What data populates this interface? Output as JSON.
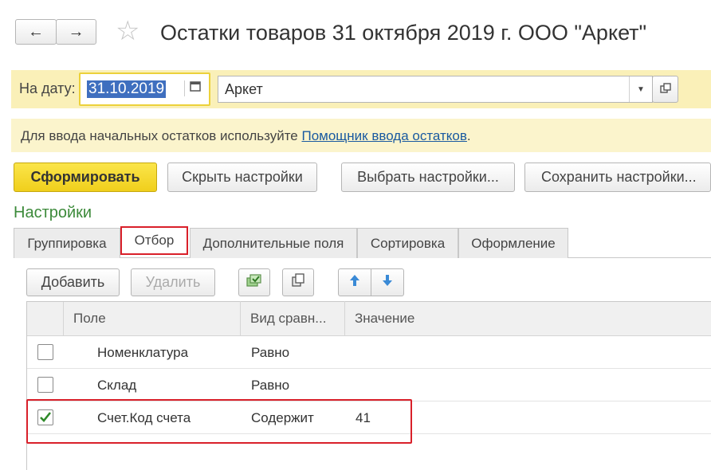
{
  "header": {
    "back_icon": "arrow-left",
    "forward_icon": "arrow-right",
    "favorite_icon": "star-outline",
    "title": "Остатки товаров 31 октября 2019 г. ООО \"Аркет\""
  },
  "params": {
    "date_label": "На дату:",
    "date_value": "31.10.2019",
    "company_value": "Аркет"
  },
  "info": {
    "text": "Для ввода начальных остатков используйте ",
    "link": "Помощник ввода остатков",
    "tail": "."
  },
  "toolbar": {
    "generate": "Сформировать",
    "hide_settings": "Скрыть настройки",
    "choose_settings": "Выбрать настройки...",
    "save_settings": "Сохранить настройки..."
  },
  "settings_title": "Настройки",
  "tabs": [
    "Группировка",
    "Отбор",
    "Дополнительные поля",
    "Сортировка",
    "Оформление"
  ],
  "filter_toolbar": {
    "add": "Добавить",
    "delete": "Удалить"
  },
  "table": {
    "columns": [
      "Поле",
      "Вид сравн...",
      "Значение"
    ],
    "rows": [
      {
        "checked": false,
        "field": "Номенклатура",
        "compare": "Равно",
        "value": ""
      },
      {
        "checked": false,
        "field": "Склад",
        "compare": "Равно",
        "value": ""
      },
      {
        "checked": true,
        "field": "Счет.Код счета",
        "compare": "Содержит",
        "value": "41"
      }
    ]
  },
  "colors": {
    "accent_yellow": "#f5d829",
    "param_bar": "#faf0b8",
    "info_bar": "#fbf4cc",
    "settings_green": "#3c8a3a",
    "link_blue": "#1a5aa0",
    "highlight_red": "#d9202a"
  }
}
